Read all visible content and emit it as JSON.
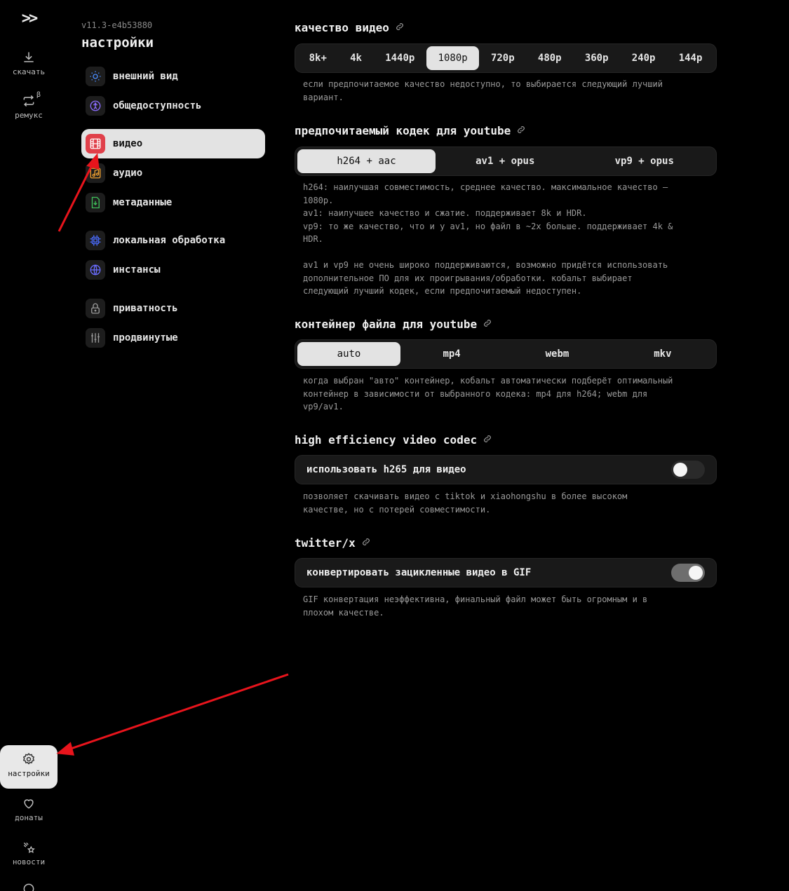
{
  "rail": {
    "download_label": "скачать",
    "remux_label": "ремукс",
    "remux_beta": "β",
    "settings_label": "настройки",
    "donate_label": "донаты",
    "news_label": "новости"
  },
  "panel": {
    "version": "v11.3-e4b53880",
    "title": "настройки",
    "items": [
      {
        "label": "внешний вид",
        "icon": "sun-icon"
      },
      {
        "label": "общедоступность",
        "icon": "accessibility-icon"
      },
      {
        "label": "видео",
        "icon": "film-icon",
        "active": true
      },
      {
        "label": "аудио",
        "icon": "music-icon"
      },
      {
        "label": "метаданные",
        "icon": "file-download-icon"
      },
      {
        "label": "локальная обработка",
        "icon": "cpu-icon"
      },
      {
        "label": "инстансы",
        "icon": "globe-icon"
      },
      {
        "label": "приватность",
        "icon": "lock-icon"
      },
      {
        "label": "продвинутые",
        "icon": "sliders-icon"
      }
    ]
  },
  "quality": {
    "title": "качество видео",
    "options": [
      "8k+",
      "4k",
      "1440p",
      "1080p",
      "720p",
      "480p",
      "360p",
      "240p",
      "144p"
    ],
    "selected": "1080p",
    "desc": "если предпочитаемое качество недоступно, то выбирается следующий лучший\nвариант."
  },
  "codec": {
    "title": "предпочитаемый кодек для youtube",
    "options": [
      "h264 + aac",
      "av1 + opus",
      "vp9 + opus"
    ],
    "selected": "h264 + aac",
    "desc": "h264: наилучшая совместимость, среднее качество. максимальное качество —\n1080p.\nav1: наилучшее качество и сжатие. поддерживает 8k и HDR.\nvp9: то же качество, что и у av1, но файл в ~2x больше. поддерживает 4k &\nHDR.\n\nav1 и vp9 не очень широко поддерживаются, возможно придётся использовать\nдополнительное ПО для их проигрывания/обработки. кобальт выбирает\nследующий лучший кодек, если предпочитаемый недоступен."
  },
  "container": {
    "title": "контейнер файла для youtube",
    "options": [
      "auto",
      "mp4",
      "webm",
      "mkv"
    ],
    "selected": "auto",
    "desc": "когда выбран \"авто\" контейнер, кобальт автоматически подберёт оптимальный\nконтейнер в зависимости от выбранного кодека: mp4 для h264; webm для\nvp9/av1."
  },
  "hevc": {
    "title": "high efficiency video codec",
    "toggle_label": "использовать h265 для видео",
    "enabled": false,
    "desc": "позволяет скачивать видео с tiktok и xiaohongshu в более высоком\nкачестве, но с потерей совместимости."
  },
  "twitter": {
    "title": "twitter/x",
    "toggle_label": "конвертировать зацикленные видео в GIF",
    "enabled": true,
    "desc": "GIF конвертация неэффективна, финальный файл может быть огромным и в\nплохом качестве."
  },
  "colors": {
    "background": "#000000",
    "surface": "#191919",
    "selected": "#e3e3e3",
    "accent_red": "#e0404a",
    "annotation_arrow": "#e8141c"
  }
}
